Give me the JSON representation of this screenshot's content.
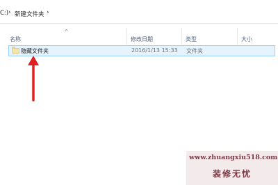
{
  "address": {
    "partial_drive": "C:)",
    "folder": "新建文件夹"
  },
  "columns": {
    "sort_indicator": "^",
    "name": "名称",
    "date": "修改日期",
    "type": "类型",
    "size": "大小"
  },
  "files": [
    {
      "name": "隐藏文件夹",
      "modified": "2016/1/13 15:33",
      "type": "文件夹",
      "selected": true
    }
  ],
  "annotation": {
    "color": "#e02020"
  },
  "watermark": {
    "url": "www.zhuangxiu518.com",
    "name": "装修无忧"
  }
}
